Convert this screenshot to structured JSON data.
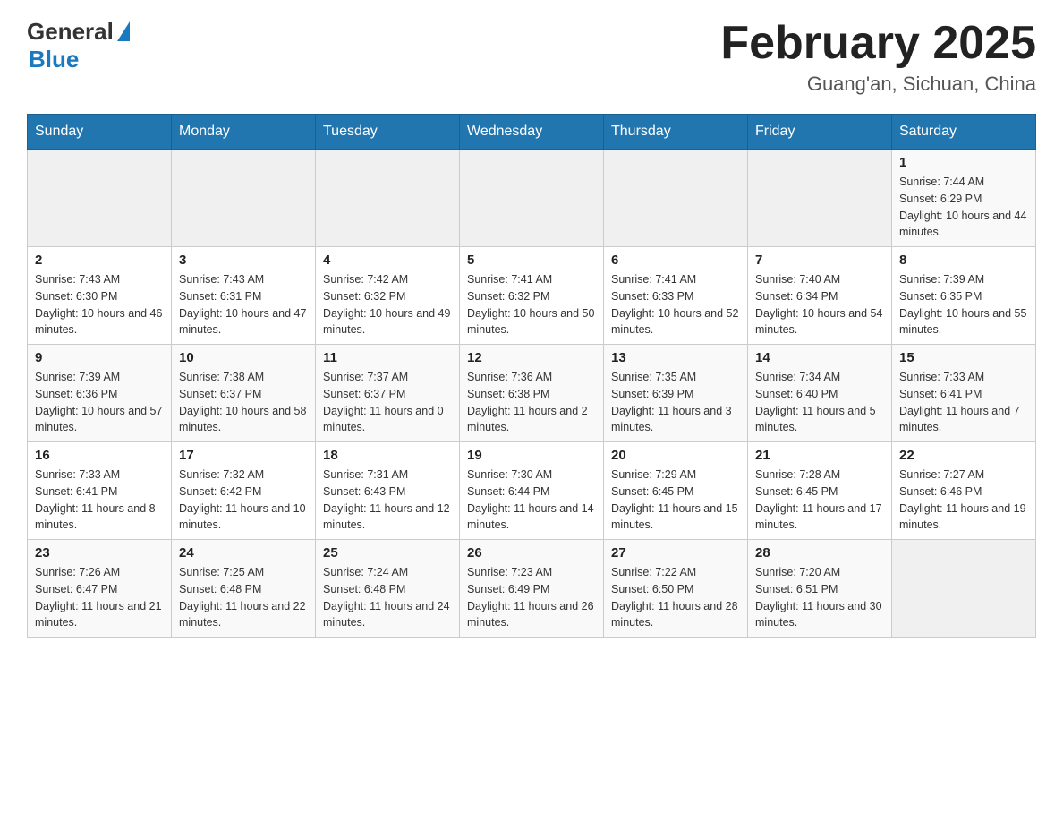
{
  "header": {
    "logo_general": "General",
    "logo_blue": "Blue",
    "month_title": "February 2025",
    "location": "Guang'an, Sichuan, China"
  },
  "weekdays": [
    "Sunday",
    "Monday",
    "Tuesday",
    "Wednesday",
    "Thursday",
    "Friday",
    "Saturday"
  ],
  "weeks": [
    [
      {
        "day": "",
        "sunrise": "",
        "sunset": "",
        "daylight": ""
      },
      {
        "day": "",
        "sunrise": "",
        "sunset": "",
        "daylight": ""
      },
      {
        "day": "",
        "sunrise": "",
        "sunset": "",
        "daylight": ""
      },
      {
        "day": "",
        "sunrise": "",
        "sunset": "",
        "daylight": ""
      },
      {
        "day": "",
        "sunrise": "",
        "sunset": "",
        "daylight": ""
      },
      {
        "day": "",
        "sunrise": "",
        "sunset": "",
        "daylight": ""
      },
      {
        "day": "1",
        "sunrise": "Sunrise: 7:44 AM",
        "sunset": "Sunset: 6:29 PM",
        "daylight": "Daylight: 10 hours and 44 minutes."
      }
    ],
    [
      {
        "day": "2",
        "sunrise": "Sunrise: 7:43 AM",
        "sunset": "Sunset: 6:30 PM",
        "daylight": "Daylight: 10 hours and 46 minutes."
      },
      {
        "day": "3",
        "sunrise": "Sunrise: 7:43 AM",
        "sunset": "Sunset: 6:31 PM",
        "daylight": "Daylight: 10 hours and 47 minutes."
      },
      {
        "day": "4",
        "sunrise": "Sunrise: 7:42 AM",
        "sunset": "Sunset: 6:32 PM",
        "daylight": "Daylight: 10 hours and 49 minutes."
      },
      {
        "day": "5",
        "sunrise": "Sunrise: 7:41 AM",
        "sunset": "Sunset: 6:32 PM",
        "daylight": "Daylight: 10 hours and 50 minutes."
      },
      {
        "day": "6",
        "sunrise": "Sunrise: 7:41 AM",
        "sunset": "Sunset: 6:33 PM",
        "daylight": "Daylight: 10 hours and 52 minutes."
      },
      {
        "day": "7",
        "sunrise": "Sunrise: 7:40 AM",
        "sunset": "Sunset: 6:34 PM",
        "daylight": "Daylight: 10 hours and 54 minutes."
      },
      {
        "day": "8",
        "sunrise": "Sunrise: 7:39 AM",
        "sunset": "Sunset: 6:35 PM",
        "daylight": "Daylight: 10 hours and 55 minutes."
      }
    ],
    [
      {
        "day": "9",
        "sunrise": "Sunrise: 7:39 AM",
        "sunset": "Sunset: 6:36 PM",
        "daylight": "Daylight: 10 hours and 57 minutes."
      },
      {
        "day": "10",
        "sunrise": "Sunrise: 7:38 AM",
        "sunset": "Sunset: 6:37 PM",
        "daylight": "Daylight: 10 hours and 58 minutes."
      },
      {
        "day": "11",
        "sunrise": "Sunrise: 7:37 AM",
        "sunset": "Sunset: 6:37 PM",
        "daylight": "Daylight: 11 hours and 0 minutes."
      },
      {
        "day": "12",
        "sunrise": "Sunrise: 7:36 AM",
        "sunset": "Sunset: 6:38 PM",
        "daylight": "Daylight: 11 hours and 2 minutes."
      },
      {
        "day": "13",
        "sunrise": "Sunrise: 7:35 AM",
        "sunset": "Sunset: 6:39 PM",
        "daylight": "Daylight: 11 hours and 3 minutes."
      },
      {
        "day": "14",
        "sunrise": "Sunrise: 7:34 AM",
        "sunset": "Sunset: 6:40 PM",
        "daylight": "Daylight: 11 hours and 5 minutes."
      },
      {
        "day": "15",
        "sunrise": "Sunrise: 7:33 AM",
        "sunset": "Sunset: 6:41 PM",
        "daylight": "Daylight: 11 hours and 7 minutes."
      }
    ],
    [
      {
        "day": "16",
        "sunrise": "Sunrise: 7:33 AM",
        "sunset": "Sunset: 6:41 PM",
        "daylight": "Daylight: 11 hours and 8 minutes."
      },
      {
        "day": "17",
        "sunrise": "Sunrise: 7:32 AM",
        "sunset": "Sunset: 6:42 PM",
        "daylight": "Daylight: 11 hours and 10 minutes."
      },
      {
        "day": "18",
        "sunrise": "Sunrise: 7:31 AM",
        "sunset": "Sunset: 6:43 PM",
        "daylight": "Daylight: 11 hours and 12 minutes."
      },
      {
        "day": "19",
        "sunrise": "Sunrise: 7:30 AM",
        "sunset": "Sunset: 6:44 PM",
        "daylight": "Daylight: 11 hours and 14 minutes."
      },
      {
        "day": "20",
        "sunrise": "Sunrise: 7:29 AM",
        "sunset": "Sunset: 6:45 PM",
        "daylight": "Daylight: 11 hours and 15 minutes."
      },
      {
        "day": "21",
        "sunrise": "Sunrise: 7:28 AM",
        "sunset": "Sunset: 6:45 PM",
        "daylight": "Daylight: 11 hours and 17 minutes."
      },
      {
        "day": "22",
        "sunrise": "Sunrise: 7:27 AM",
        "sunset": "Sunset: 6:46 PM",
        "daylight": "Daylight: 11 hours and 19 minutes."
      }
    ],
    [
      {
        "day": "23",
        "sunrise": "Sunrise: 7:26 AM",
        "sunset": "Sunset: 6:47 PM",
        "daylight": "Daylight: 11 hours and 21 minutes."
      },
      {
        "day": "24",
        "sunrise": "Sunrise: 7:25 AM",
        "sunset": "Sunset: 6:48 PM",
        "daylight": "Daylight: 11 hours and 22 minutes."
      },
      {
        "day": "25",
        "sunrise": "Sunrise: 7:24 AM",
        "sunset": "Sunset: 6:48 PM",
        "daylight": "Daylight: 11 hours and 24 minutes."
      },
      {
        "day": "26",
        "sunrise": "Sunrise: 7:23 AM",
        "sunset": "Sunset: 6:49 PM",
        "daylight": "Daylight: 11 hours and 26 minutes."
      },
      {
        "day": "27",
        "sunrise": "Sunrise: 7:22 AM",
        "sunset": "Sunset: 6:50 PM",
        "daylight": "Daylight: 11 hours and 28 minutes."
      },
      {
        "day": "28",
        "sunrise": "Sunrise: 7:20 AM",
        "sunset": "Sunset: 6:51 PM",
        "daylight": "Daylight: 11 hours and 30 minutes."
      },
      {
        "day": "",
        "sunrise": "",
        "sunset": "",
        "daylight": ""
      }
    ]
  ]
}
